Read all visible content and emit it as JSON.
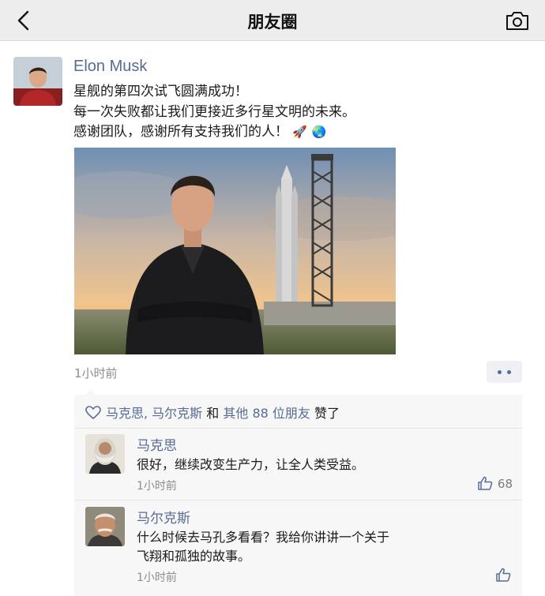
{
  "nav": {
    "title": "朋友圈"
  },
  "post": {
    "author": "Elon Musk",
    "lines": [
      "星舰的第四次试飞圆满成功！",
      "每一次失败都让我们更接近多行星文明的未来。",
      "感谢团队，感谢所有支持我们的人！"
    ],
    "emoji_rocket": "🚀",
    "emoji_globe": "🌏",
    "time": "1小时前"
  },
  "likes": {
    "names": "马克思, 马尔克斯",
    "and": " 和 ",
    "others": "其他 88 位朋友",
    "suffix": " 赞了"
  },
  "comments": [
    {
      "name": "马克思",
      "text": "很好，继续改变生产力，让全人类受益。",
      "time": "1小时前",
      "likes": "68"
    },
    {
      "name": "马尔克斯",
      "text_line1": "什么时候去马孔多看看？我给你讲讲一个关于",
      "text_line2": "飞翔和孤独的故事。",
      "time": "1小时前"
    }
  ],
  "colors": {
    "link": "#576b95",
    "nav_bg": "#ededed",
    "comment_bg": "#f7f7f7"
  }
}
